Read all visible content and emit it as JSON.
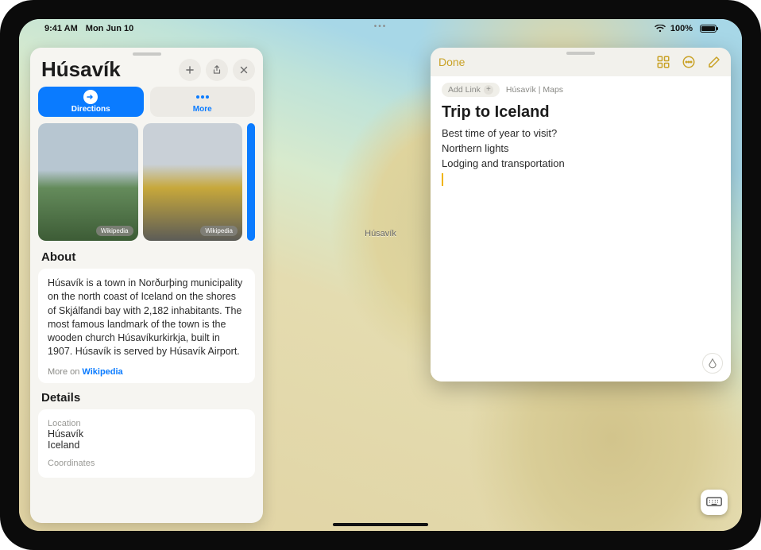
{
  "status": {
    "time": "9:41 AM",
    "date": "Mon Jun 10",
    "battery": "100%"
  },
  "map": {
    "label": "Húsavík"
  },
  "place": {
    "title": "Húsavík",
    "directions_label": "Directions",
    "more_label": "More",
    "photo_source": "Wikipedia",
    "about_heading": "About",
    "about_text": "Húsavík is a town in Norðurþing municipality on the north coast of Iceland on the shores of Skjálfandi bay with 2,182 inhabitants. The most famous landmark of the town is the wooden church Húsavíkurkirkja, built in 1907. Húsavík is served by Húsavík Airport.",
    "more_on": "More on",
    "more_on_link": "Wikipedia",
    "details_heading": "Details",
    "location_label": "Location",
    "location_line1": "Húsavík",
    "location_line2": "Iceland",
    "coordinates_label": "Coordinates"
  },
  "notes": {
    "done": "Done",
    "add_link": "Add Link",
    "breadcrumb": "Húsavík | Maps",
    "title": "Trip to Iceland",
    "lines": [
      "Best time of year to visit?",
      "Northern lights",
      "Lodging and transportation"
    ]
  }
}
